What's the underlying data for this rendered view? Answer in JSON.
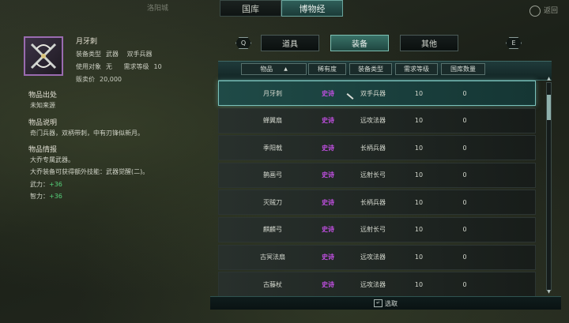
{
  "top_tabs": [
    {
      "label": "国库",
      "active": false
    },
    {
      "label": "博物经",
      "active": true
    }
  ],
  "top_left_text": "洛阳城",
  "top_right_text": "返回",
  "item": {
    "name": "月牙刺",
    "equip_type_key": "装备类型",
    "equip_type_val": "武器",
    "equip_sub_val": "双手兵器",
    "user_key": "使用对象",
    "user_val": "无",
    "level_key": "需求等级",
    "level_val": "10",
    "price_key": "贩卖价",
    "price_val": "20,000"
  },
  "sections": {
    "origin_title": "物品出处",
    "origin_text": "未知来源",
    "desc_title": "物品说明",
    "desc_text": "奇门兵器，双柄带刺，中有刃锋似新月。",
    "info_title": "物品情报",
    "info_line1": "大乔专属武器。",
    "info_line2": "大乔装备可获得额外技能：武器觉醒(二)。",
    "stat1_key": "武力：",
    "stat1_val": "+36",
    "stat2_key": "智力：",
    "stat2_val": "+36"
  },
  "nav": {
    "left_key": "Q",
    "right_key": "E"
  },
  "cat_tabs": [
    {
      "label": "道具",
      "active": false
    },
    {
      "label": "装备",
      "active": true
    },
    {
      "label": "其他",
      "active": false
    }
  ],
  "columns": [
    "物品",
    "稀有度",
    "装备类型",
    "需求等级",
    "国库数量"
  ],
  "rows": [
    {
      "name": "月牙刺",
      "rarity": "史诗",
      "type": "双手兵器",
      "level": "10",
      "count": "0"
    },
    {
      "name": "蝉翼扇",
      "rarity": "史诗",
      "type": "远攻法器",
      "level": "10",
      "count": "0"
    },
    {
      "name": "季阳戟",
      "rarity": "史诗",
      "type": "长柄兵器",
      "level": "10",
      "count": "0"
    },
    {
      "name": "鹊画弓",
      "rarity": "史诗",
      "type": "远射长弓",
      "level": "10",
      "count": "0"
    },
    {
      "name": "灭贼刀",
      "rarity": "史诗",
      "type": "长柄兵器",
      "level": "10",
      "count": "0"
    },
    {
      "name": "麒麟弓",
      "rarity": "史诗",
      "type": "远射长弓",
      "level": "10",
      "count": "0"
    },
    {
      "name": "古冥法扇",
      "rarity": "史诗",
      "type": "远攻法器",
      "level": "10",
      "count": "0"
    },
    {
      "name": "古藤杖",
      "rarity": "史诗",
      "type": "远攻法器",
      "level": "10",
      "count": "0"
    }
  ],
  "footer": {
    "key": "↵",
    "label": "选取"
  },
  "colors": {
    "epic": "#c04fe0",
    "stat": "#56d07a",
    "accent": "#397268"
  }
}
